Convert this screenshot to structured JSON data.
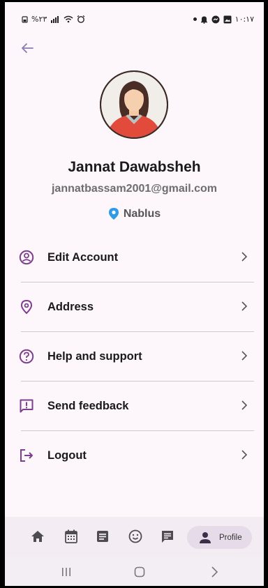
{
  "status_bar": {
    "left_text": "%٢٣",
    "time": "١٠:١٧"
  },
  "profile": {
    "name": "Jannat Dawabsheh",
    "email": "jannatbassam2001@gmail.com",
    "city": "Nablus"
  },
  "menu": [
    {
      "label": "Edit Account",
      "icon": "account-circle-icon"
    },
    {
      "label": "Address",
      "icon": "location-pin-icon"
    },
    {
      "label": "Help and support",
      "icon": "help-circle-icon"
    },
    {
      "label": "Send feedback",
      "icon": "feedback-icon"
    },
    {
      "label": "Logout",
      "icon": "logout-icon"
    }
  ],
  "bottom_nav": {
    "items": [
      "home-icon",
      "calendar-icon",
      "article-icon",
      "mood-icon",
      "chat-icon"
    ],
    "active_label": "Profile"
  },
  "colors": {
    "accent": "#7b3f8c",
    "background": "#fdf6fb",
    "pin_blue": "#2e9be6"
  }
}
